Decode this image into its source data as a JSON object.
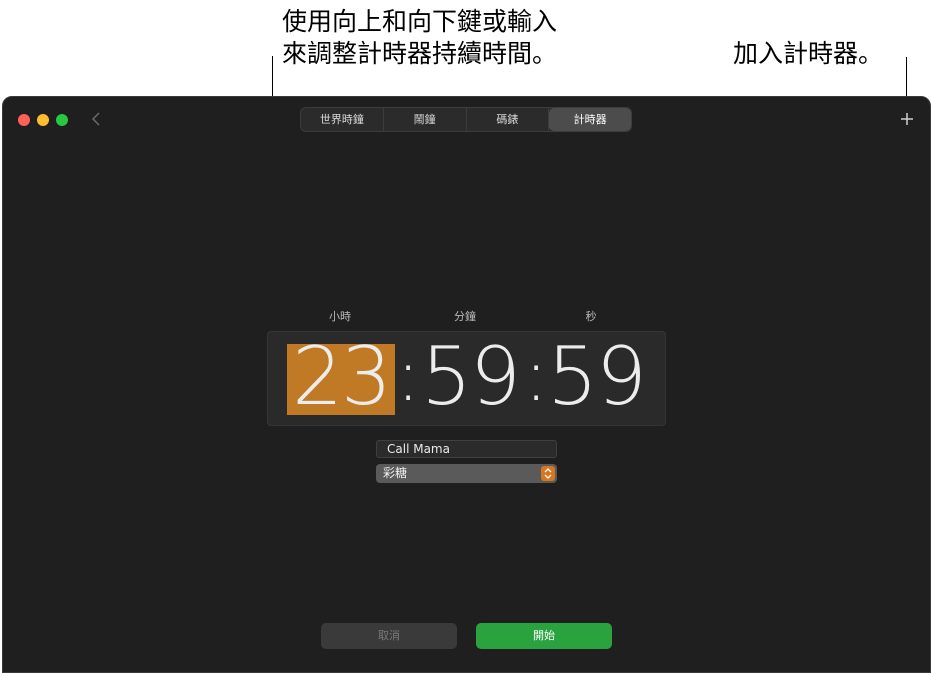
{
  "callouts": {
    "arrow_keys_line1": "使用向上和向下鍵或輸入",
    "arrow_keys_line2": "來調整計時器持續時間。",
    "add_timer": "加入計時器。"
  },
  "window": {
    "tabs": [
      {
        "label": "世界時鐘",
        "active": false
      },
      {
        "label": "鬧鐘",
        "active": false
      },
      {
        "label": "碼錶",
        "active": false
      },
      {
        "label": "計時器",
        "active": true
      }
    ],
    "add_icon": "plus-icon",
    "back_icon": "chevron-left-icon"
  },
  "timer": {
    "labels": {
      "hours": "小時",
      "minutes": "分鐘",
      "seconds": "秒"
    },
    "hours": "23",
    "minutes": "59",
    "seconds": "59",
    "separator": ":",
    "highlight_color": "#c07a25"
  },
  "label_field": {
    "value": "Call Mama"
  },
  "sound_select": {
    "value": "彩糖",
    "accent": "#d9741f"
  },
  "buttons": {
    "cancel": "取消",
    "start": "開始",
    "start_color": "#2aa33e"
  }
}
